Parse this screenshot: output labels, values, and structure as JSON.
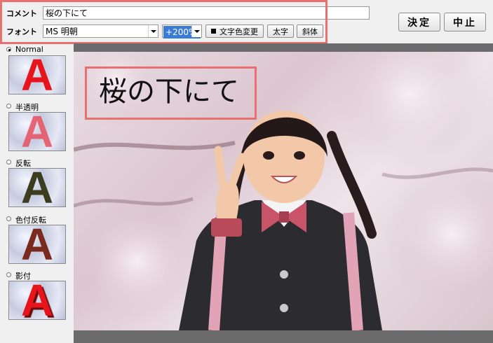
{
  "toolbar": {
    "comment_label": "コメント",
    "comment_value": "桜の下にて",
    "font_label": "フォント",
    "font_value": "MS 明朝",
    "zoom_value": "+200%",
    "text_color_button": "文字色変更",
    "bold_button": "太字",
    "italic_button": "斜体",
    "ok_button": "決定",
    "cancel_button": "中止"
  },
  "styles": {
    "options": [
      {
        "label": "Normal",
        "selected": true,
        "letter": "A",
        "color": "#e8141c"
      },
      {
        "label": "半透明",
        "selected": false,
        "letter": "A",
        "color": "#e85060"
      },
      {
        "label": "反転",
        "selected": false,
        "letter": "A",
        "color": "#3c3d1e"
      },
      {
        "label": "色付反転",
        "selected": false,
        "letter": "A",
        "color": "#7a2a1e"
      },
      {
        "label": "影付",
        "selected": false,
        "letter": "A",
        "color": "#e8141c"
      }
    ]
  },
  "canvas": {
    "overlay_text": "桜の下にて"
  },
  "colors": {
    "highlight": "#e8706e",
    "selection": "#3a7bd5"
  }
}
